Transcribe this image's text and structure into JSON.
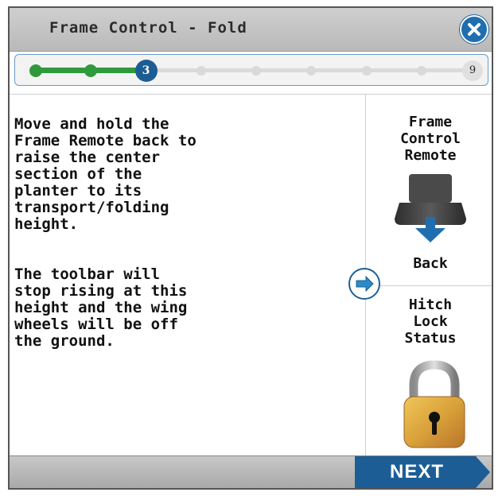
{
  "header": {
    "title": "Frame Control - Fold",
    "close_icon": "close-icon"
  },
  "progress": {
    "current": 3,
    "current_label": "3",
    "total_label": "9",
    "total": 9
  },
  "instructions": {
    "paragraph1": "Move and hold the\nFrame Remote back to\nraise the center\nsection of the\nplanter to its\ntransport/folding\nheight.",
    "paragraph2": "The toolbar will\nstop rising at this\nheight and the wing\nwheels will be off\nthe ground."
  },
  "frame_control": {
    "title": "Frame\nControl\nRemote",
    "direction_label": "Back",
    "icon": "frame-remote-back-icon"
  },
  "hitch": {
    "title": "Hitch\nLock\nStatus",
    "icon": "padlock-locked-icon"
  },
  "advance_icon": "arrow-right-icon",
  "footer": {
    "next_label": "NEXT"
  },
  "colors": {
    "accent_blue": "#1d5d95",
    "progress_green": "#2f9a3d",
    "lock_gold": "#d9a23a"
  }
}
